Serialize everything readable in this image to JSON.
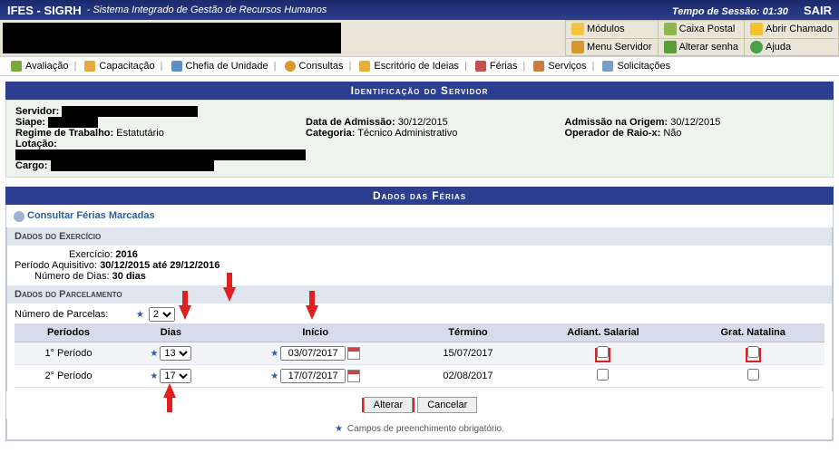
{
  "top": {
    "sys": "IFES - SIGRH",
    "desc": "- Sistema Integrado de Gestão de Recursos Humanos",
    "session": "Tempo de Sessão: 01:30",
    "sair": "SAIR"
  },
  "modules": {
    "modulos": "Módulos",
    "caixa": "Caixa Postal",
    "chamado": "Abrir Chamado",
    "menu": "Menu Servidor",
    "senha": "Alterar senha",
    "ajuda": "Ajuda"
  },
  "menubar": {
    "avaliacao": "Avaliação",
    "capacitacao": "Capacitação",
    "chefia": "Chefia de Unidade",
    "consultas": "Consultas",
    "escritorio": "Escritório de Ideias",
    "ferias": "Férias",
    "servicos": "Serviços",
    "solicitacoes": "Solicitações"
  },
  "id_header": "Identificação do Servidor",
  "id": {
    "servidor_lbl": "Servidor:",
    "siape_lbl": "Siape:",
    "regime_lbl": "Regime de Trabalho:",
    "regime_val": "Estatutário",
    "lotacao_lbl": "Lotação:",
    "cargo_lbl": "Cargo:",
    "data_adm_lbl": "Data de Admissão:",
    "data_adm_val": "30/12/2015",
    "categoria_lbl": "Categoria:",
    "categoria_val": "Técnico Administrativo",
    "adm_origem_lbl": "Admissão na Origem:",
    "adm_origem_val": "30/12/2015",
    "raiox_lbl": "Operador de Raio-x:",
    "raiox_val": "Não"
  },
  "ferias_hdr": "Dados das Férias",
  "consultar": "Consultar Férias Marcadas",
  "exercicio_hdr": "Dados do Exercício",
  "exercicio": {
    "ex_lbl": "Exercício:",
    "ex_val": "2016",
    "periodo_lbl": "Período Aquisitivo:",
    "periodo_val": "30/12/2015 até 29/12/2016",
    "dias_lbl": "Número de Dias:",
    "dias_val": "30 dias"
  },
  "parcel_hdr": "Dados do Parcelamento",
  "parcel": {
    "num_lbl": "Número de Parcelas:",
    "num_val": "2"
  },
  "table": {
    "h_periodos": "Períodos",
    "h_dias": "Dias",
    "h_inicio": "Início",
    "h_termino": "Término",
    "h_adiant": "Adiant. Salarial",
    "h_grat": "Grat. Natalina",
    "rows": [
      {
        "periodo": "1° Período",
        "dias": "13",
        "inicio": "03/07/2017",
        "termino": "15/07/2017"
      },
      {
        "periodo": "2° Período",
        "dias": "17",
        "inicio": "17/07/2017",
        "termino": "02/08/2017"
      }
    ]
  },
  "buttons": {
    "alterar": "Alterar",
    "cancelar": "Cancelar"
  },
  "footnote": "Campos de preenchimento obrigatório."
}
